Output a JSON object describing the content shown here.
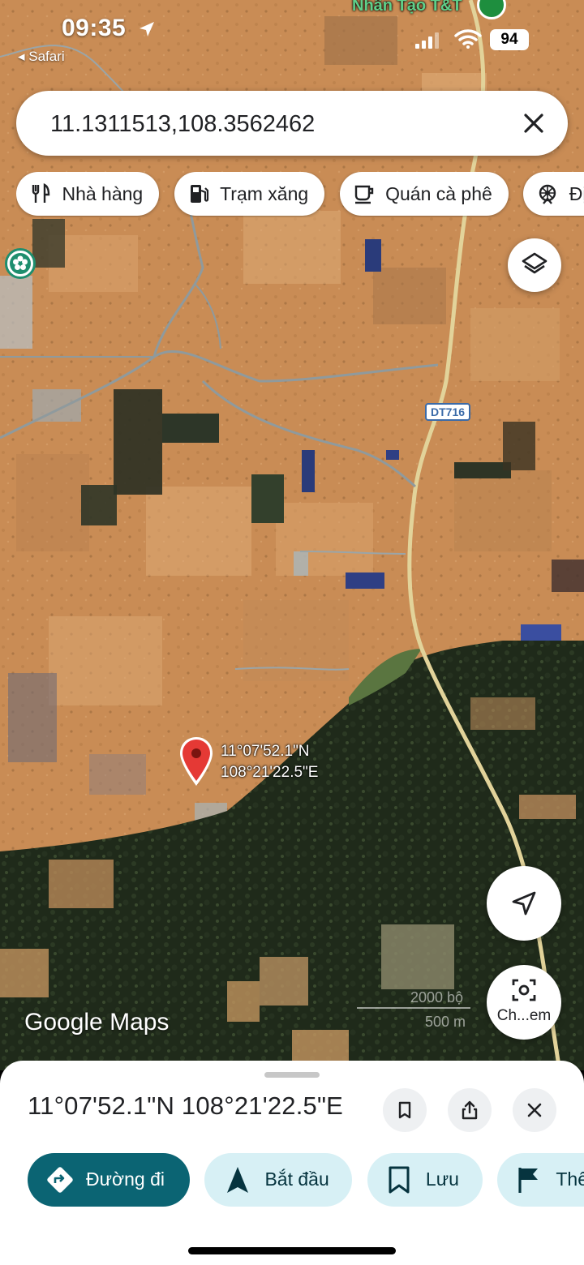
{
  "status_bar": {
    "time": "09:35",
    "back_app": "◂ Safari",
    "battery": "94"
  },
  "map": {
    "top_place_label": "Nhân Tạo T&T",
    "road_label": "DT716",
    "pin_lat": "11°07'52.1\"N",
    "pin_lon": "108°21'22.5\"E",
    "watermark": "Google Maps",
    "scale_top": "2000 bộ",
    "scale_bottom": "500 m"
  },
  "search": {
    "value": "11.1311513,108.3562462"
  },
  "chips": [
    {
      "label": "Nhà hàng",
      "icon": "restaurant-icon"
    },
    {
      "label": "Trạm xăng",
      "icon": "gas-station-icon"
    },
    {
      "label": "Quán cà phê",
      "icon": "coffee-icon"
    },
    {
      "label": "Địa",
      "icon": "attraction-icon"
    }
  ],
  "lens_label": "Ch...em",
  "sheet": {
    "coords": "11°07'52.1\"N 108°21'22.5\"E",
    "actions": [
      {
        "label": "Đường đi",
        "icon": "directions-icon"
      },
      {
        "label": "Bắt đầu",
        "icon": "navigation-arrow-icon"
      },
      {
        "label": "Lưu",
        "icon": "bookmark-icon"
      },
      {
        "label": "Thêm",
        "icon": "flag-icon"
      }
    ]
  },
  "colors": {
    "primary_action": "#0b6473",
    "secondary_action": "#d7f0f5",
    "pin": "#e53935"
  }
}
